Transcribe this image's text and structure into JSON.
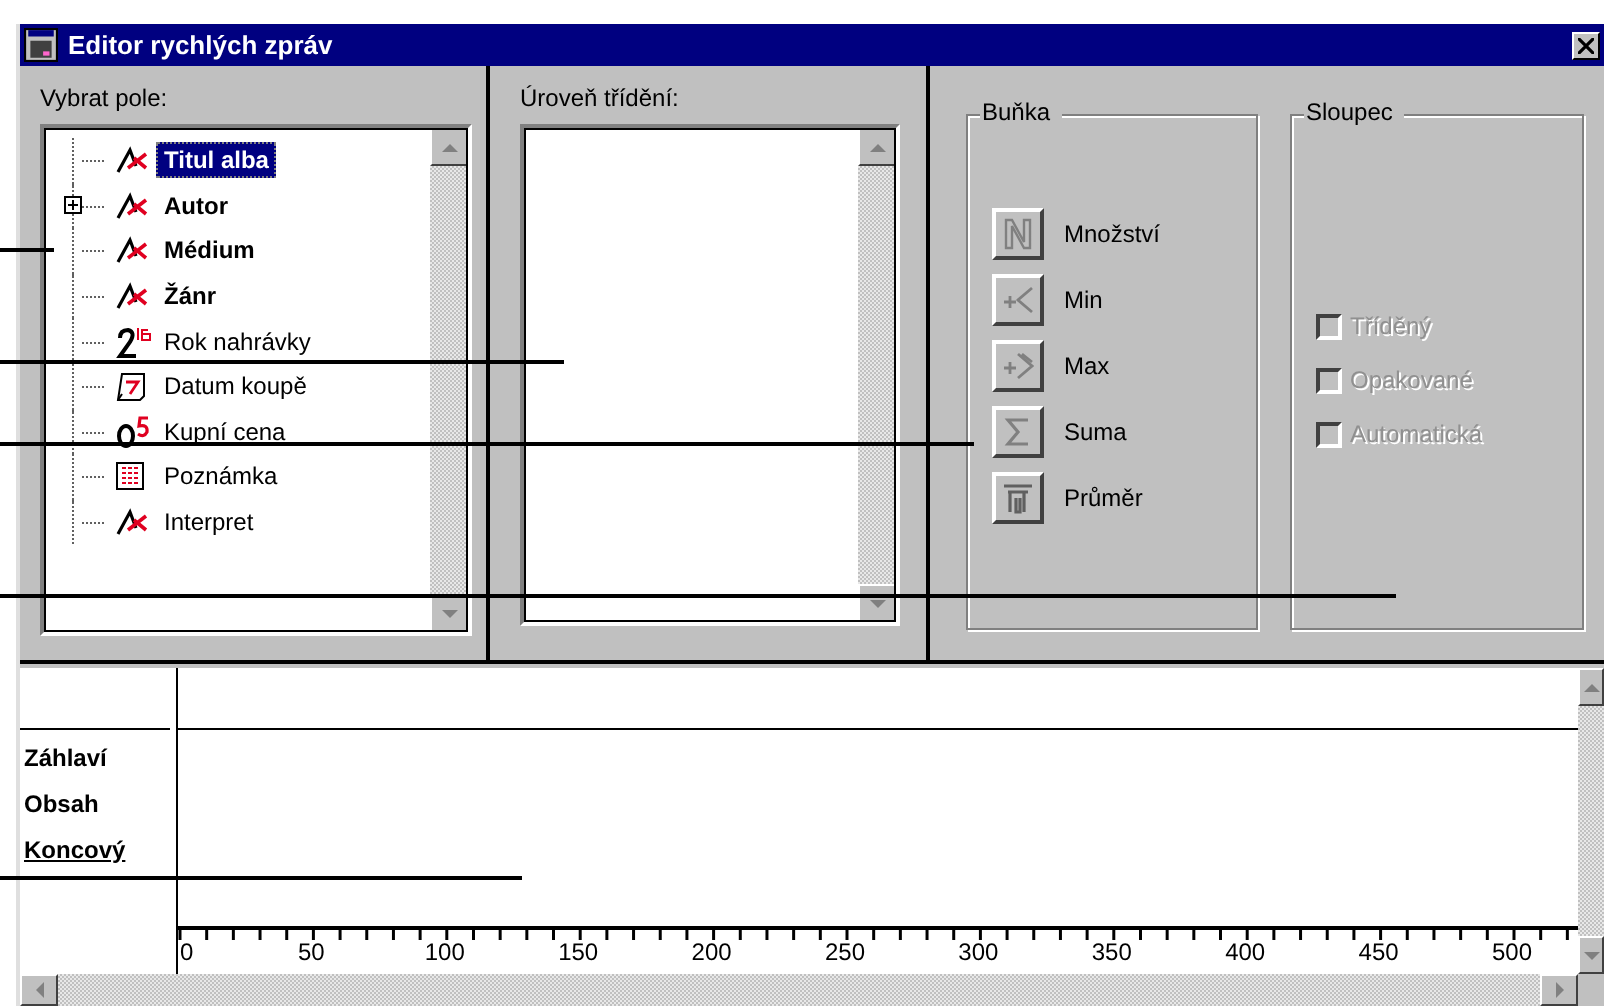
{
  "window": {
    "title": "Editor rychlých zpráv"
  },
  "field_panel": {
    "label": "Vybrat pole:",
    "items": [
      {
        "label": "Titul alba",
        "kind": "text",
        "bold": true,
        "expandable": false,
        "selected": true
      },
      {
        "label": "Autor",
        "kind": "text",
        "bold": true,
        "expandable": true,
        "selected": false
      },
      {
        "label": "Médium",
        "kind": "text",
        "bold": true,
        "expandable": false,
        "selected": false
      },
      {
        "label": "Žánr",
        "kind": "text",
        "bold": true,
        "expandable": false,
        "selected": false
      },
      {
        "label": "Rok nahrávky",
        "kind": "number",
        "bold": false,
        "expandable": false,
        "selected": false
      },
      {
        "label": "Datum koupě",
        "kind": "date",
        "bold": false,
        "expandable": false,
        "selected": false
      },
      {
        "label": "Kupní cena",
        "kind": "currency",
        "bold": false,
        "expandable": false,
        "selected": false
      },
      {
        "label": "Poznámka",
        "kind": "memo",
        "bold": false,
        "expandable": false,
        "selected": false
      },
      {
        "label": "Interpret",
        "kind": "text",
        "bold": false,
        "expandable": false,
        "selected": false
      }
    ]
  },
  "sort_panel": {
    "label": "Úroveň třídění:"
  },
  "cell_group": {
    "label": "Buňka",
    "buttons": [
      {
        "kind": "count",
        "label": "Množství"
      },
      {
        "kind": "min",
        "label": "Min"
      },
      {
        "kind": "max",
        "label": "Max"
      },
      {
        "kind": "sum",
        "label": "Suma"
      },
      {
        "kind": "average",
        "label": "Průměr"
      }
    ]
  },
  "column_group": {
    "label": "Sloupec",
    "options": [
      {
        "label": "Tříděný",
        "checked": false,
        "disabled": true
      },
      {
        "label": "Opakované",
        "checked": false,
        "disabled": true
      },
      {
        "label": "Automatická",
        "checked": false,
        "disabled": true
      }
    ]
  },
  "layout": {
    "sections": [
      {
        "label": "Záhlaví",
        "selected": false
      },
      {
        "label": "Obsah",
        "selected": false
      },
      {
        "label": "Koncový",
        "selected": true
      }
    ],
    "ruler": [
      "0",
      "50",
      "100",
      "150",
      "200",
      "250",
      "300",
      "350",
      "400",
      "450",
      "500"
    ]
  }
}
